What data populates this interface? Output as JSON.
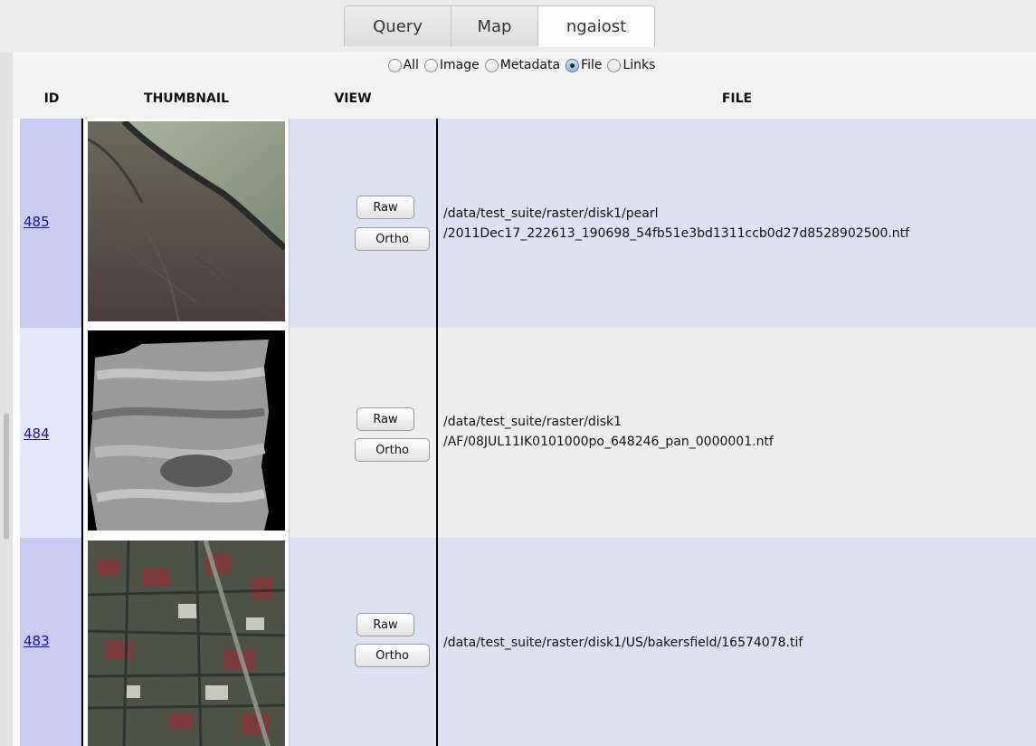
{
  "tabs": [
    "Query",
    "Map",
    "ngaiost"
  ],
  "filter": {
    "options": [
      "All",
      "Image",
      "Metadata",
      "File",
      "Links"
    ],
    "selected": "File"
  },
  "columns": {
    "id": "ID",
    "thumbnail": "THUMBNAIL",
    "view": "VIEW",
    "file": "FILE"
  },
  "buttons": {
    "raw": "Raw",
    "ortho": "Ortho"
  },
  "rows": [
    {
      "id": "485",
      "file_line1": "/data/test_suite/raster/disk1/pearl",
      "file_line2": "/2011Dec17_222613_190698_54fb51e3bd1311ccb0d27d8528902500.ntf",
      "thumbnail": "forested-hillside-ridge"
    },
    {
      "id": "484",
      "file_line1": "/data/test_suite/raster/disk1",
      "file_line2": "/AF/08JUL11IK0101000po_648246_pan_0000001.ntf",
      "thumbnail": "panchromatic-terrain"
    },
    {
      "id": "483",
      "file_line1": "/data/test_suite/raster/disk1/US/bakersfield/16574078.tif",
      "file_line2": "",
      "thumbnail": "urban-grid-aerial"
    }
  ],
  "colors": {
    "row_odd": "#dde1f1",
    "row_even": "#efefef",
    "id_odd": "#c9cbf3",
    "id_even": "#e6e7fb",
    "link": "#1a0dab"
  }
}
